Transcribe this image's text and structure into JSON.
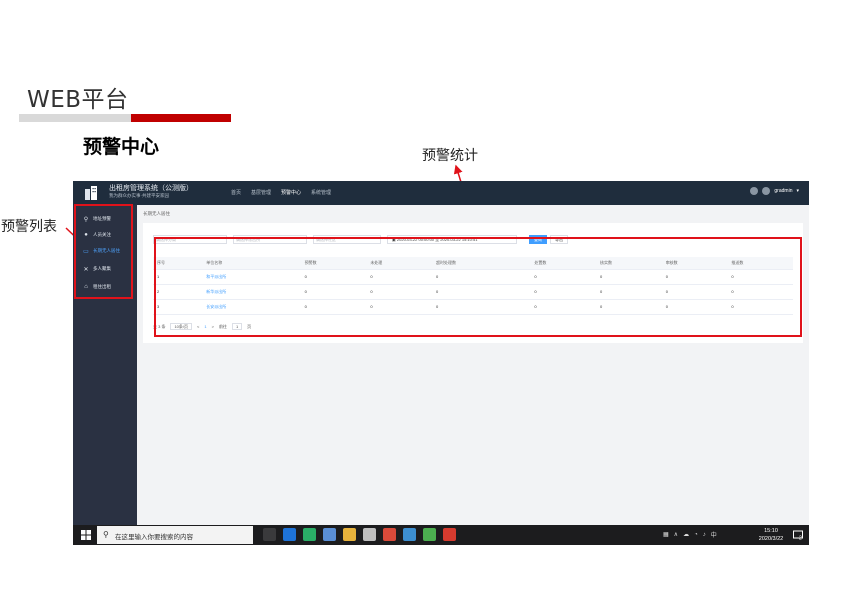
{
  "slide": {
    "title": "WEB平台",
    "section_title": "预警中心",
    "callout_stats": "预警统计",
    "callout_list": "预警列表",
    "accent_colors": {
      "red": "#c00000",
      "gray": "#d9d9d9",
      "highlight": "#e0121a"
    }
  },
  "app": {
    "system_title": "出租房管理系统（公测版）",
    "system_subtitle": "我为群众办实事·共建平安家园",
    "nav": [
      "首页",
      "基层管理",
      "预警中心",
      "系统管理"
    ],
    "active_nav_index": 2,
    "user": "gradmin"
  },
  "sidebar": {
    "items": [
      {
        "label": "地址预警",
        "icon": "pin-icon"
      },
      {
        "label": "人员关注",
        "icon": "person-icon"
      },
      {
        "label": "长期无人居住",
        "icon": "doc-icon"
      },
      {
        "label": "多人聚集",
        "icon": "group-icon"
      },
      {
        "label": "租住出租",
        "icon": "house-icon"
      }
    ],
    "active_index": 2
  },
  "content": {
    "breadcrumb": "长期无人居住",
    "filters": {
      "district_placeholder": "请选择分局",
      "station_placeholder": "请选择派出所",
      "community_placeholder": "请选择社区",
      "start": "2020-03-22 00:00:00",
      "separator": "至",
      "end": "2020-03-22 15:10:51"
    },
    "query_label": "查询",
    "export_label": "导出",
    "table": {
      "headers": [
        "序号",
        "单位名称",
        "预警数",
        "未处理",
        "超时处理数",
        "处置数",
        "核实数",
        "审核数",
        "推送数"
      ],
      "rows": [
        [
          "1",
          "和平派出所",
          "0",
          "0",
          "0",
          "0",
          "0",
          "0",
          "0"
        ],
        [
          "2",
          "新华派出所",
          "0",
          "0",
          "0",
          "0",
          "0",
          "0",
          "0"
        ],
        [
          "3",
          "长安派出所",
          "0",
          "0",
          "0",
          "0",
          "0",
          "0",
          "0"
        ]
      ]
    },
    "pager": {
      "total": "共 3 条",
      "page_size": "10条/页",
      "prev": "<",
      "current": "1",
      "next": ">",
      "goto": "前往",
      "goto_value": "1",
      "page_unit": "页"
    }
  },
  "taskbar": {
    "search_placeholder": "在这里输入你要搜索的内容",
    "tray_text": "中",
    "time": "15:10",
    "date": "2020/3/22",
    "notification_count": "2"
  }
}
